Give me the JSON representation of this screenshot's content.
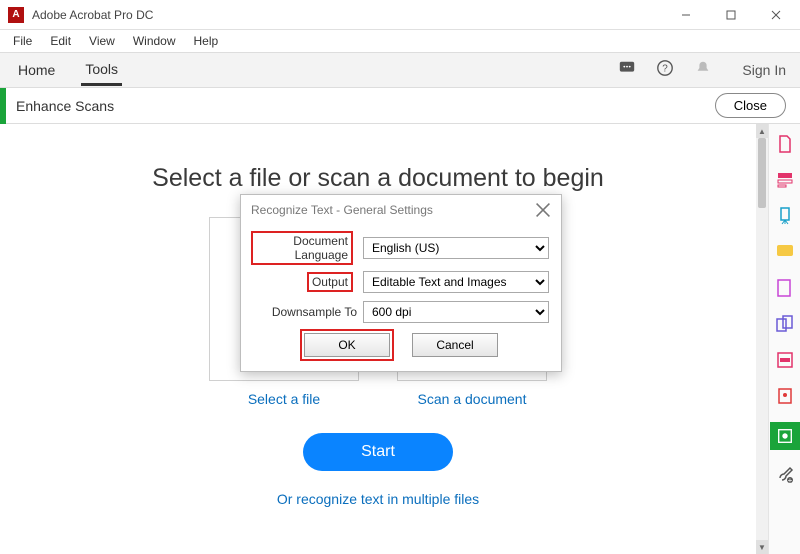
{
  "window": {
    "title": "Adobe Acrobat Pro DC",
    "app_icon_glyph": "A"
  },
  "menubar": [
    "File",
    "Edit",
    "View",
    "Window",
    "Help"
  ],
  "tabbar": {
    "home": "Home",
    "tools": "Tools",
    "sign_in": "Sign In"
  },
  "toolbar": {
    "name": "Enhance Scans",
    "close": "Close"
  },
  "main": {
    "headline": "Select a file or scan a document to begin",
    "select_file": "Select a file",
    "scan_doc": "Scan a document",
    "start": "Start",
    "multi": "Or recognize text in multiple files"
  },
  "dialog": {
    "title": "Recognize Text - General Settings",
    "rows": {
      "lang_label": "Document Language",
      "lang_value": "English (US)",
      "output_label": "Output",
      "output_value": "Editable Text and Images",
      "downsample_label": "Downsample To",
      "downsample_value": "600 dpi"
    },
    "ok": "OK",
    "cancel": "Cancel"
  }
}
